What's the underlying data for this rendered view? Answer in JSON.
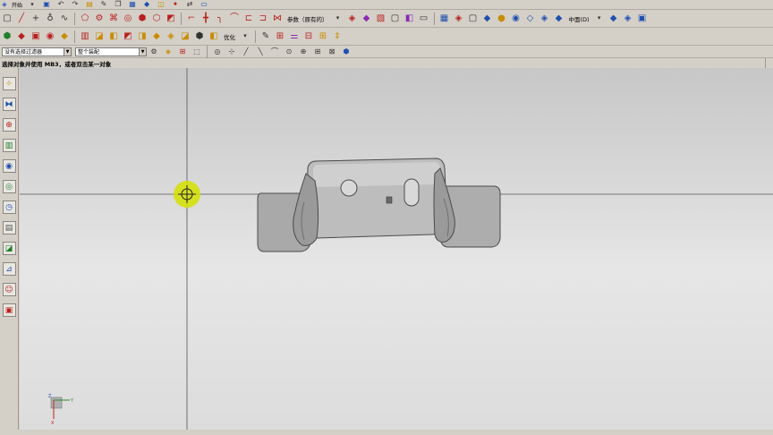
{
  "menubar": {
    "start_label": "开始",
    "icons": [
      "save-icon",
      "undo-icon",
      "redo-icon",
      "cut-icon",
      "copy-icon",
      "paste-icon",
      "window-icon"
    ]
  },
  "toolbar1": {
    "section_label": "参数（原有的）",
    "view_label": "中面(D)"
  },
  "toolbar2": {
    "optimize_label": "优化"
  },
  "selection_bar": {
    "filter_value": "没有选择过滤器",
    "scope_value": "整个装配"
  },
  "prompt": {
    "text": "选择对象并使用 MB3，或者双击某一对象"
  },
  "viewport": {
    "axis_labels": {
      "x": "X",
      "y": "Y",
      "z": "Z"
    }
  },
  "colors": {
    "viewport_top": "#c7c7c7",
    "viewport_bottom": "#e6e6e6",
    "cursor_highlight": "#d4e000",
    "part_fill": "#a8a8a8"
  }
}
